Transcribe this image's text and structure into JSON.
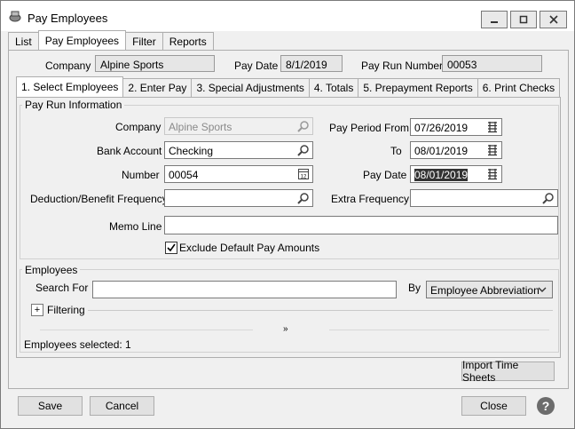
{
  "window": {
    "title": "Pay Employees",
    "controls": {
      "minimize": "minimize-icon",
      "maximize": "maximize-icon",
      "close": "close-icon"
    }
  },
  "outer_tabs": [
    "List",
    "Pay Employees",
    "Filter",
    "Reports"
  ],
  "header": {
    "company_label": "Company",
    "company_value": "Alpine Sports",
    "pay_date_label": "Pay Date",
    "pay_date_value": "8/1/2019",
    "pay_run_number_label": "Pay Run Number",
    "pay_run_number_value": "00053"
  },
  "inner_tabs": [
    "1. Select Employees",
    "2. Enter Pay",
    "3. Special Adjustments",
    "4. Totals",
    "5. Prepayment Reports",
    "6. Print Checks"
  ],
  "pay_run_info": {
    "group_title": "Pay Run Information",
    "company_label": "Company",
    "company_value": "Alpine Sports",
    "bank_account_label": "Bank Account",
    "bank_account_value": "Checking",
    "number_label": "Number",
    "number_value": "00054",
    "deduction_label": "Deduction/Benefit Frequency",
    "deduction_value": "",
    "memo_label": "Memo Line",
    "memo_value": "",
    "exclude_label": "Exclude Default Pay Amounts",
    "exclude_checked": true,
    "pay_period_from_label": "Pay Period From",
    "pay_period_from_value": "07/26/2019",
    "to_label": "To",
    "to_value": "08/01/2019",
    "pay_date_label": "Pay Date",
    "pay_date_value": "08/01/2019",
    "extra_frequency_label": "Extra Frequency",
    "extra_frequency_value": ""
  },
  "employees": {
    "group_title": "Employees",
    "search_label": "Search For",
    "search_value": "",
    "by_label": "By",
    "by_value": "Employee Abbreviation",
    "filtering_label": "Filtering",
    "move_label": "»",
    "selected_text": "Employees selected: 1"
  },
  "buttons": {
    "import": "Import Time Sheets",
    "save": "Save",
    "cancel": "Cancel",
    "close": "Close",
    "help": "?"
  }
}
